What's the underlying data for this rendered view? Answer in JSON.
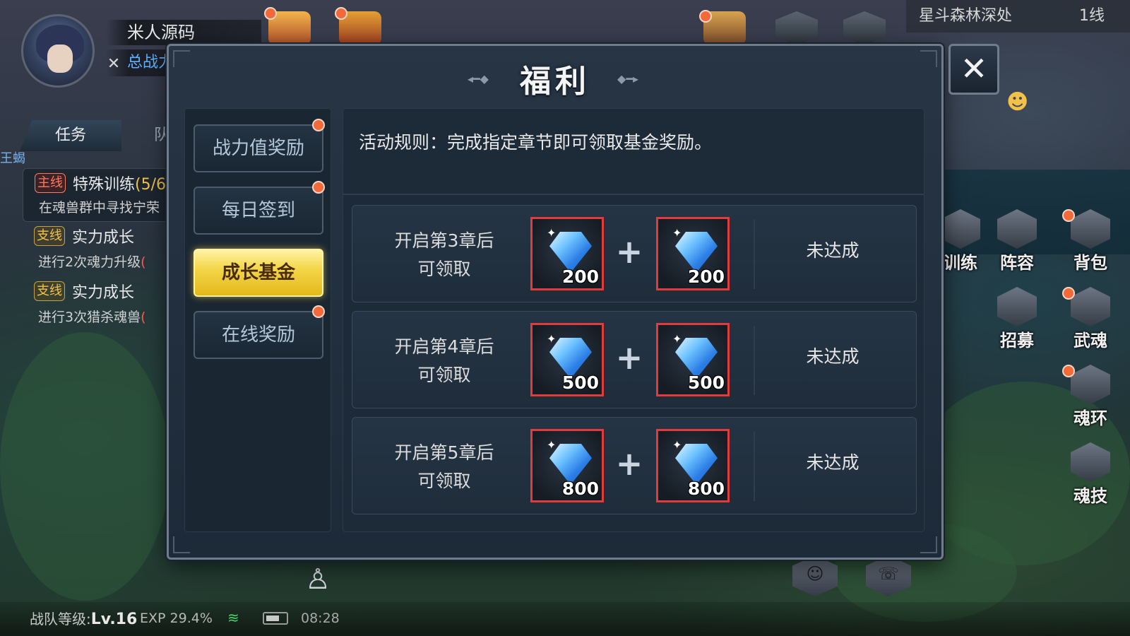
{
  "player": {
    "name": "米人源码",
    "power_label": "总战力"
  },
  "location": {
    "name": "星斗森林深处",
    "line": "1线"
  },
  "quest_panel": {
    "tabs": [
      "任务",
      "队"
    ],
    "map_edge_label": "王蝎",
    "quests": [
      {
        "tag": "主线",
        "title": "特殊训练",
        "progress": "(5/6",
        "desc": "在魂兽群中寻找宁荣",
        "desc_progress": ""
      },
      {
        "tag": "支线",
        "title": "实力成长",
        "progress": "",
        "desc": "进行2次魂力升级",
        "desc_progress": "("
      },
      {
        "tag": "支线",
        "title": "实力成长",
        "progress": "",
        "desc": "进行3次猎杀魂兽",
        "desc_progress": "("
      }
    ]
  },
  "side_menu": {
    "training": "训练",
    "lineup": "阵容",
    "bag": "背包",
    "recruit": "招募",
    "martial_soul": "武魂",
    "soul_ring": "魂环",
    "soul_skill": "魂技"
  },
  "bottom_bar": {
    "team_level_label": "战队等级:",
    "team_level_value": "Lv.16",
    "exp": "EXP 29.4%",
    "clock": "08:28"
  },
  "dialog": {
    "title": "福利",
    "close_icon": "close-x",
    "tabs": [
      {
        "label": "战力值奖励",
        "active": false,
        "has_dot": true
      },
      {
        "label": "每日签到",
        "active": false,
        "has_dot": true
      },
      {
        "label": "成长基金",
        "active": true,
        "has_dot": false
      },
      {
        "label": "在线奖励",
        "active": false,
        "has_dot": true
      }
    ],
    "rules": "活动规则：完成指定章节即可领取基金奖励。",
    "rewards": [
      {
        "condition_line1": "开启第3章后",
        "condition_line2": "可领取",
        "item1_count": "200",
        "item2_count": "200",
        "status": "未达成"
      },
      {
        "condition_line1": "开启第4章后",
        "condition_line2": "可领取",
        "item1_count": "500",
        "item2_count": "500",
        "status": "未达成"
      },
      {
        "condition_line1": "开启第5章后",
        "condition_line2": "可领取",
        "item1_count": "800",
        "item2_count": "800",
        "status": "未达成"
      }
    ]
  },
  "colors": {
    "active_tab": "#f4d74a",
    "red_dot": "#f26a3a",
    "item_border": "#e23b3b",
    "power_text": "#5fb2ff"
  }
}
